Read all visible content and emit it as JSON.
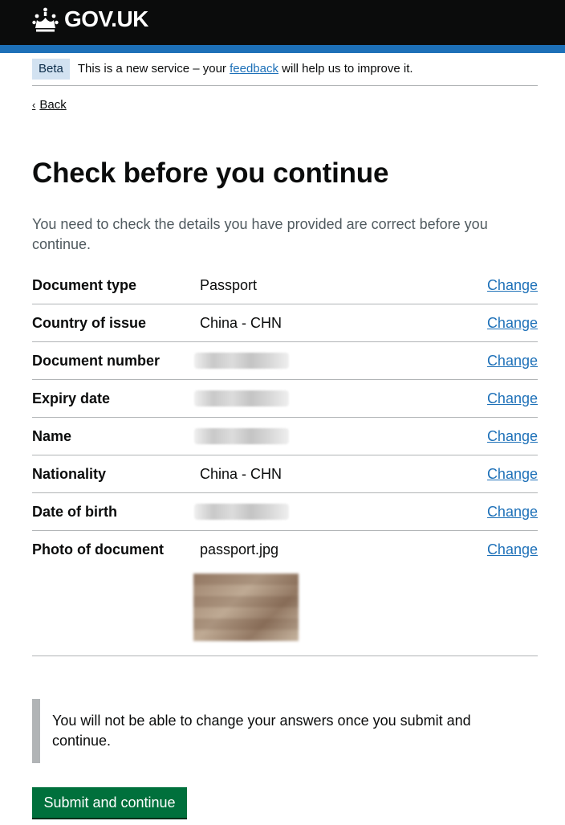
{
  "header": {
    "logo_text": "GOV.UK",
    "colors": {
      "bar": "#0b0c0c",
      "accent": "#1d70b8"
    }
  },
  "phase_banner": {
    "tag": "Beta",
    "text_before": "This is a new service – your ",
    "link": "feedback",
    "text_after": " will help us to improve it."
  },
  "back_link": "Back",
  "title": "Check before you continue",
  "intro": "You need to check the details you have provided are correct before you continue.",
  "summary": {
    "rows": [
      {
        "key": "Document type",
        "value": "Passport",
        "action": "Change"
      },
      {
        "key": "Country of issue",
        "value": "China - CHN",
        "action": "Change"
      },
      {
        "key": "Document number",
        "value": "",
        "action": "Change"
      },
      {
        "key": "Expiry date",
        "value": "",
        "action": "Change"
      },
      {
        "key": "Name",
        "value": "",
        "action": "Change"
      },
      {
        "key": "Nationality",
        "value": "China - CHN",
        "action": "Change"
      },
      {
        "key": "Date of birth",
        "value": "",
        "action": "Change"
      },
      {
        "key": "Photo of document",
        "value": "passport.jpg",
        "action": "Change"
      }
    ]
  },
  "inset_text": "You will not be able to change your answers once you submit and continue.",
  "submit_button": "Submit and continue"
}
